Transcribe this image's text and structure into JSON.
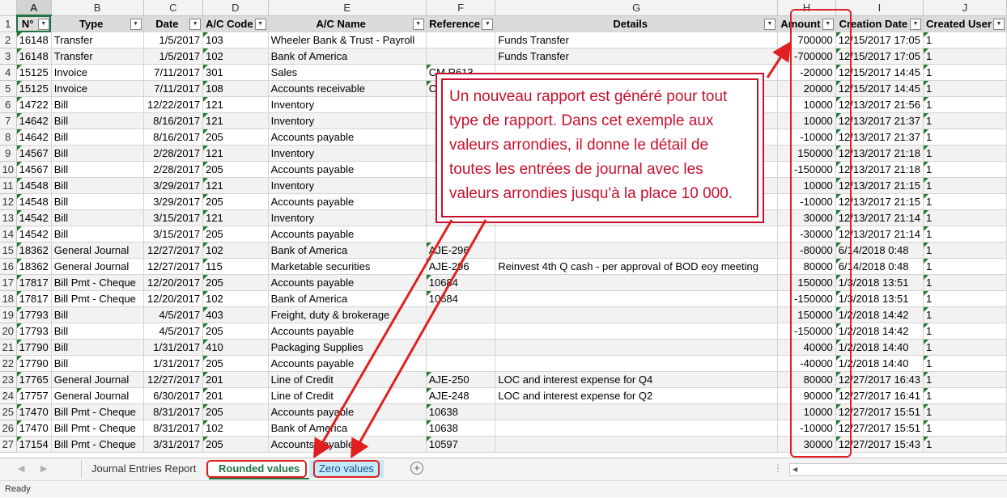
{
  "columns": [
    "A",
    "B",
    "C",
    "D",
    "E",
    "F",
    "G",
    "H",
    "I",
    "J"
  ],
  "headers": [
    "N°",
    "Type",
    "Date",
    "A/C Code",
    "A/C Name",
    "Reference",
    "Details",
    "Amount",
    "Creation Date",
    "Created User"
  ],
  "rows": [
    [
      "16148",
      "Transfer",
      "1/5/2017",
      "103",
      "Wheeler Bank & Trust - Payroll",
      "",
      "Funds Transfer",
      "700000",
      "12/15/2017 17:05",
      "1"
    ],
    [
      "16148",
      "Transfer",
      "1/5/2017",
      "102",
      "Bank of America",
      "",
      "Funds Transfer",
      "-700000",
      "12/15/2017 17:05",
      "1"
    ],
    [
      "15125",
      "Invoice",
      "7/11/2017",
      "301",
      "Sales",
      "CM R613",
      "",
      "-20000",
      "12/15/2017 14:45",
      "1"
    ],
    [
      "15125",
      "Invoice",
      "7/11/2017",
      "108",
      "Accounts receivable",
      "CM R613",
      "",
      "20000",
      "12/15/2017 14:45",
      "1"
    ],
    [
      "14722",
      "Bill",
      "12/22/2017",
      "121",
      "Inventory",
      "",
      "",
      "10000",
      "12/13/2017 21:56",
      "1"
    ],
    [
      "14642",
      "Bill",
      "8/16/2017",
      "121",
      "Inventory",
      "",
      "",
      "10000",
      "12/13/2017 21:37",
      "1"
    ],
    [
      "14642",
      "Bill",
      "8/16/2017",
      "205",
      "Accounts payable",
      "",
      "",
      "-10000",
      "12/13/2017 21:37",
      "1"
    ],
    [
      "14567",
      "Bill",
      "2/28/2017",
      "121",
      "Inventory",
      "",
      "",
      "150000",
      "12/13/2017 21:18",
      "1"
    ],
    [
      "14567",
      "Bill",
      "2/28/2017",
      "205",
      "Accounts payable",
      "",
      "",
      "-150000",
      "12/13/2017 21:18",
      "1"
    ],
    [
      "14548",
      "Bill",
      "3/29/2017",
      "121",
      "Inventory",
      "",
      "",
      "10000",
      "12/13/2017 21:15",
      "1"
    ],
    [
      "14548",
      "Bill",
      "3/29/2017",
      "205",
      "Accounts payable",
      "",
      "",
      "-10000",
      "12/13/2017 21:15",
      "1"
    ],
    [
      "14542",
      "Bill",
      "3/15/2017",
      "121",
      "Inventory",
      "",
      "",
      "30000",
      "12/13/2017 21:14",
      "1"
    ],
    [
      "14542",
      "Bill",
      "3/15/2017",
      "205",
      "Accounts payable",
      "",
      "",
      "-30000",
      "12/13/2017 21:14",
      "1"
    ],
    [
      "18362",
      "General Journal",
      "12/27/2017",
      "102",
      "Bank of America",
      "AJE-296",
      "",
      "-80000",
      "6/14/2018 0:48",
      "1"
    ],
    [
      "18362",
      "General Journal",
      "12/27/2017",
      "115",
      "Marketable securities",
      "AJE-296",
      "Reinvest 4th Q cash - per approval of BOD eoy meeting",
      "80000",
      "6/14/2018 0:48",
      "1"
    ],
    [
      "17817",
      "Bill Pmt - Cheque",
      "12/20/2017",
      "205",
      "Accounts payable",
      "10684",
      "",
      "150000",
      "1/3/2018 13:51",
      "1"
    ],
    [
      "17817",
      "Bill Pmt - Cheque",
      "12/20/2017",
      "102",
      "Bank of America",
      "10684",
      "",
      "-150000",
      "1/3/2018 13:51",
      "1"
    ],
    [
      "17793",
      "Bill",
      "4/5/2017",
      "403",
      "Freight, duty & brokerage",
      "",
      "",
      "150000",
      "1/2/2018 14:42",
      "1"
    ],
    [
      "17793",
      "Bill",
      "4/5/2017",
      "205",
      "Accounts payable",
      "",
      "",
      "-150000",
      "1/2/2018 14:42",
      "1"
    ],
    [
      "17790",
      "Bill",
      "1/31/2017",
      "410",
      "Packaging Supplies",
      "",
      "",
      "40000",
      "1/2/2018 14:40",
      "1"
    ],
    [
      "17790",
      "Bill",
      "1/31/2017",
      "205",
      "Accounts payable",
      "",
      "",
      "-40000",
      "1/2/2018 14:40",
      "1"
    ],
    [
      "17765",
      "General Journal",
      "12/27/2017",
      "201",
      "Line of Credit",
      "AJE-250",
      "LOC and interest expense for Q4",
      "80000",
      "12/27/2017 16:43",
      "1"
    ],
    [
      "17757",
      "General Journal",
      "6/30/2017",
      "201",
      "Line of Credit",
      "AJE-248",
      "LOC and interest expense for Q2",
      "90000",
      "12/27/2017 16:41",
      "1"
    ],
    [
      "17470",
      "Bill Pmt - Cheque",
      "8/31/2017",
      "205",
      "Accounts payable",
      "10638",
      "",
      "10000",
      "12/27/2017 15:51",
      "1"
    ],
    [
      "17470",
      "Bill Pmt - Cheque",
      "8/31/2017",
      "102",
      "Bank of America",
      "10638",
      "",
      "-10000",
      "12/27/2017 15:51",
      "1"
    ],
    [
      "17154",
      "Bill Pmt - Cheque",
      "3/31/2017",
      "205",
      "Accounts payable",
      "10597",
      "",
      "30000",
      "12/27/2017 15:43",
      "1"
    ]
  ],
  "callout": "Un nouveau rapport est généré pour tout type de rapport. Dans cet exemple aux valeurs arrondies, il donne le détail de toutes les entrées de journal avec les valeurs arrondies jusqu'à la place 10 000.",
  "tabs": [
    "Journal Entries Report",
    "Rounded values",
    "Zero values"
  ],
  "status": "Ready",
  "colors": {
    "accent": "#217346",
    "annotation": "#e02020",
    "callout_text": "#c8102e"
  }
}
